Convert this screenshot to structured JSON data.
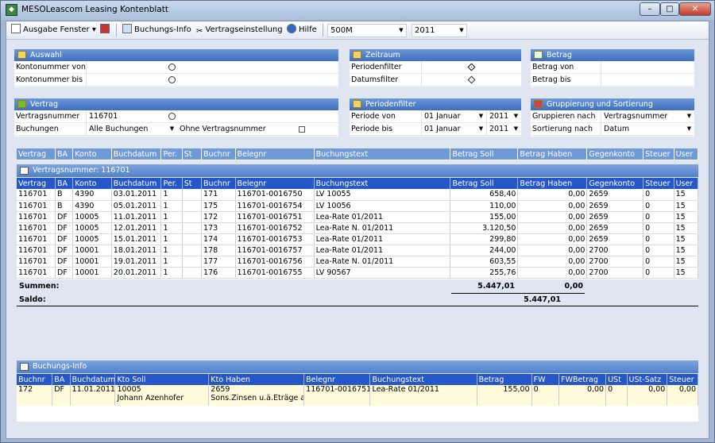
{
  "window": {
    "title": "MESOLeascom Leasing Kontenblatt",
    "minimize": "–",
    "maximize": "□",
    "close": "✕"
  },
  "toolbar": {
    "ausgabe": "Ausgabe Fenster",
    "buchungsinfo": "Buchungs-Info",
    "vertragseinstellung": "Vertragseinstellung",
    "hilfe": "Hilfe",
    "mandant": "500M",
    "jahr": "2011"
  },
  "auswahl": {
    "title": "Auswahl",
    "kontonummer_von": "Kontonummer von",
    "kontonummer_bis": "Kontonummer bis"
  },
  "zeitraum": {
    "title": "Zeitraum",
    "periodenfilter": "Periodenfilter",
    "datumsfilter": "Datumsfilter"
  },
  "betrag": {
    "title": "Betrag",
    "betrag_von": "Betrag von",
    "betrag_bis": "Betrag bis"
  },
  "vertrag": {
    "title": "Vertrag",
    "vertragsnummer_label": "Vertragsnummer",
    "vertragsnummer": "116701",
    "buchungen_label": "Buchungen",
    "buchungen": "Alle Buchungen",
    "ohne": "Ohne Vertragsnummer"
  },
  "periodenfilter": {
    "title": "Periodenfilter",
    "von_label": "Periode von",
    "von": "01 Januar",
    "von_jahr": "2011",
    "bis_label": "Periode bis",
    "bis": "01 Januar",
    "bis_jahr": "2011"
  },
  "gruppierung": {
    "title": "Gruppierung und Sortierung",
    "gruppieren_label": "Gruppieren nach",
    "gruppieren": "Vertragsnummer",
    "sortierung_label": "Sortierung nach",
    "sortierung": "Datum"
  },
  "columns": [
    "Vertrag",
    "BA",
    "Konto",
    "Buchdatum",
    "Per.",
    "St",
    "Buchnr",
    "Belegnr",
    "Buchungstext",
    "Betrag Soll",
    "Betrag Haben",
    "Gegenkonto",
    "Steuer",
    "User"
  ],
  "group_label": "Vertragsnummer: 116701",
  "rows": [
    [
      "116701",
      "B",
      "4390",
      "03.01.2011",
      "1",
      "",
      "171",
      "116701-0016750",
      "LV 10055",
      "658,40",
      "0,00",
      "2659",
      "0",
      "15"
    ],
    [
      "116701",
      "B",
      "4390",
      "05.01.2011",
      "1",
      "",
      "175",
      "116701-0016754",
      "LV 10056",
      "110,00",
      "0,00",
      "2659",
      "0",
      "15"
    ],
    [
      "116701",
      "DF",
      "10005",
      "11.01.2011",
      "1",
      "",
      "172",
      "116701-0016751",
      "Lea-Rate 01/2011",
      "155,00",
      "0,00",
      "2659",
      "0",
      "15"
    ],
    [
      "116701",
      "DF",
      "10005",
      "12.01.2011",
      "1",
      "",
      "173",
      "116701-0016752",
      "Lea-Rate N. 01/2011",
      "3.120,50",
      "0,00",
      "2659",
      "0",
      "15"
    ],
    [
      "116701",
      "DF",
      "10005",
      "15.01.2011",
      "1",
      "",
      "174",
      "116701-0016753",
      "Lea-Rate 01/2011",
      "299,80",
      "0,00",
      "2659",
      "0",
      "15"
    ],
    [
      "116701",
      "DF",
      "10001",
      "18.01.2011",
      "1",
      "",
      "178",
      "116701-0016757",
      "Lea-Rate 01/2011",
      "244,00",
      "0,00",
      "2700",
      "0",
      "15"
    ],
    [
      "116701",
      "DF",
      "10001",
      "19.01.2011",
      "1",
      "",
      "177",
      "116701-0016756",
      "Lea-Rate N. 01/2011",
      "603,55",
      "0,00",
      "2700",
      "0",
      "15"
    ],
    [
      "116701",
      "DF",
      "10001",
      "20.01.2011",
      "1",
      "",
      "176",
      "116701-0016755",
      "LV 90567",
      "255,76",
      "0,00",
      "2700",
      "0",
      "15"
    ]
  ],
  "summen": {
    "label": "Summen:",
    "soll": "5.447,01",
    "haben": "0,00",
    "saldo_label": "Saldo:",
    "saldo": "5.447,01"
  },
  "info": {
    "title": "Buchungs-Info",
    "columns": [
      "Buchnr",
      "BA",
      "Buchdatum",
      "Kto Soll",
      "Kto Haben",
      "Belegnr",
      "Buchungstext",
      "Betrag",
      "FW",
      "FWBetrag",
      "USt",
      "USt-Satz",
      "Steuer"
    ],
    "row": {
      "buchnr": "172",
      "ba": "DF",
      "datum": "11.01.2011",
      "kto_soll": "10005",
      "kto_soll_name": "Johann Azenhofer",
      "kto_haben": "2659",
      "kto_haben_name": "Sons.Zinsen u.ä.Eträge a",
      "belegnr": "116701-0016751",
      "text": "Lea-Rate 01/2011",
      "betrag": "155,00",
      "fw": "0",
      "fwbetrag": "0,00",
      "ust": "0",
      "ustsatz": "0,00",
      "steuer": "0,00"
    }
  }
}
